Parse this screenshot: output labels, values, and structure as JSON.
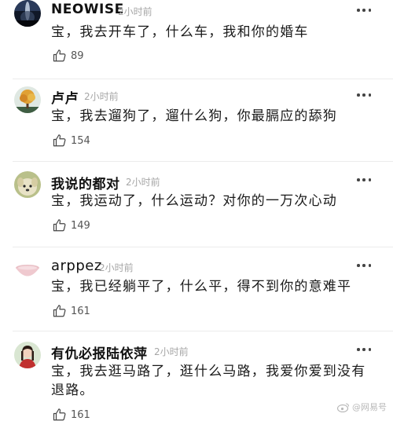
{
  "comments": [
    {
      "username": "NEOWISE",
      "time": "2小时前",
      "text": "宝，我去开车了，什么车，我和你的婚车",
      "likes": "89",
      "avatar_icon": "night-sky-avatar"
    },
    {
      "username": "卢卢",
      "time": "2小时前",
      "text": "宝，我去遛狗了，遛什么狗，你最膈应的舔狗",
      "likes": "154",
      "avatar_icon": "autumn-tree-avatar"
    },
    {
      "username": "我说的都对",
      "time": "2小时前",
      "text": "宝，我运动了，什么运动？对你的一万次心动",
      "likes": "149",
      "avatar_icon": "puppy-avatar"
    },
    {
      "username": "arppez",
      "time": "2小时前",
      "text": "宝，我已经躺平了，什么平，得不到你的意难平",
      "likes": "161",
      "avatar_icon": "pink-bowl-avatar"
    },
    {
      "username": "有仇必报陆依萍",
      "time": "2小时前",
      "text": "宝，我去逛马路了，逛什么马路，我爱你爱到没有退路。",
      "likes": "161",
      "avatar_icon": "girl-portrait-avatar"
    }
  ],
  "watermark": {
    "text": "@网易号",
    "icon": "weibo-logo-icon"
  },
  "colors": {
    "text": "#1a1a1a",
    "meta": "#a6a6a6",
    "divider": "#ececec"
  }
}
